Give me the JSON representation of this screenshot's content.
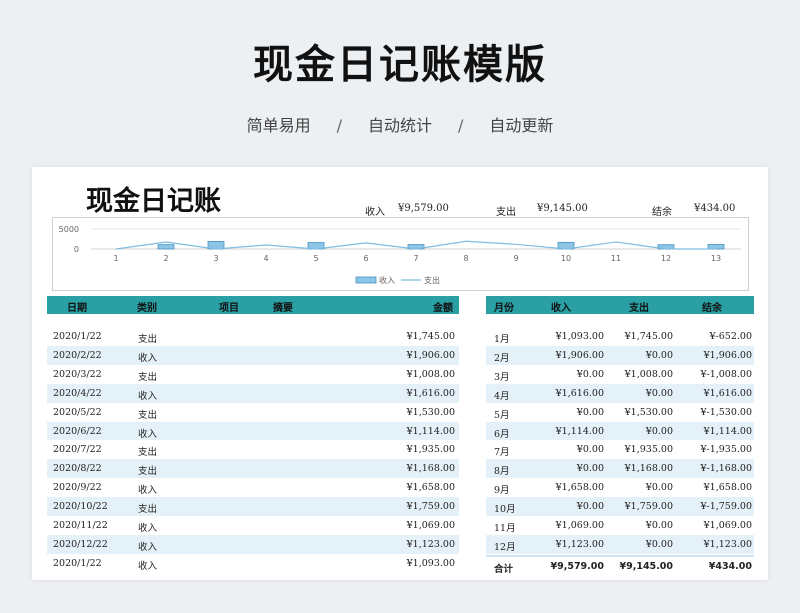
{
  "page": {
    "title": "现金日记账模版",
    "taglines": [
      "简单易用",
      "自动统计",
      "自动更新"
    ],
    "separator": "/"
  },
  "sheet": {
    "title": "现金日记账",
    "summary": [
      {
        "label": "收入",
        "value": "¥9,579.00"
      },
      {
        "label": "支出",
        "value": "¥9,145.00"
      },
      {
        "label": "结余",
        "value": "¥434.00"
      }
    ]
  },
  "chart_data": {
    "type": "bar",
    "x": [
      1,
      2,
      3,
      4,
      5,
      6,
      7,
      8,
      9,
      10,
      11,
      12,
      13
    ],
    "yticks": [
      "5000",
      "0"
    ],
    "ylim": [
      0,
      5000
    ],
    "series": [
      {
        "name": "收入",
        "type": "bar",
        "values": [
          0,
          1093,
          1906,
          0,
          1616,
          0,
          1114,
          0,
          0,
          1658,
          0,
          1069,
          1123
        ]
      },
      {
        "name": "支出",
        "type": "line",
        "values": [
          0,
          1745,
          0,
          1008,
          0,
          1530,
          0,
          1935,
          1168,
          0,
          1759,
          0,
          0
        ]
      }
    ],
    "colors": {
      "bar": "#8cc5e6",
      "bar_stroke": "#4a90c2",
      "line": "#7fbde0"
    },
    "legend": "bottom"
  },
  "ledger": {
    "headers": {
      "date": "日期",
      "category": "类别",
      "item": "项目",
      "note": "摘要",
      "amount": "金额"
    },
    "rows": [
      {
        "date": "2020/1/22",
        "category": "支出",
        "amount": "¥1,745.00"
      },
      {
        "date": "2020/2/22",
        "category": "收入",
        "amount": "¥1,906.00"
      },
      {
        "date": "2020/3/22",
        "category": "支出",
        "amount": "¥1,008.00"
      },
      {
        "date": "2020/4/22",
        "category": "收入",
        "amount": "¥1,616.00"
      },
      {
        "date": "2020/5/22",
        "category": "支出",
        "amount": "¥1,530.00"
      },
      {
        "date": "2020/6/22",
        "category": "收入",
        "amount": "¥1,114.00"
      },
      {
        "date": "2020/7/22",
        "category": "支出",
        "amount": "¥1,935.00"
      },
      {
        "date": "2020/8/22",
        "category": "支出",
        "amount": "¥1,168.00"
      },
      {
        "date": "2020/9/22",
        "category": "收入",
        "amount": "¥1,658.00"
      },
      {
        "date": "2020/10/22",
        "category": "支出",
        "amount": "¥1,759.00"
      },
      {
        "date": "2020/11/22",
        "category": "收入",
        "amount": "¥1,069.00"
      },
      {
        "date": "2020/12/22",
        "category": "收入",
        "amount": "¥1,123.00"
      },
      {
        "date": "2020/1/22",
        "category": "收入",
        "amount": "¥1,093.00"
      }
    ]
  },
  "monthly": {
    "headers": {
      "month": "月份",
      "income": "收入",
      "expense": "支出",
      "balance": "结余"
    },
    "rows": [
      {
        "month": "1月",
        "income": "¥1,093.00",
        "expense": "¥1,745.00",
        "balance": "¥-652.00"
      },
      {
        "month": "2月",
        "income": "¥1,906.00",
        "expense": "¥0.00",
        "balance": "¥1,906.00"
      },
      {
        "month": "3月",
        "income": "¥0.00",
        "expense": "¥1,008.00",
        "balance": "¥-1,008.00"
      },
      {
        "month": "4月",
        "income": "¥1,616.00",
        "expense": "¥0.00",
        "balance": "¥1,616.00"
      },
      {
        "month": "5月",
        "income": "¥0.00",
        "expense": "¥1,530.00",
        "balance": "¥-1,530.00"
      },
      {
        "month": "6月",
        "income": "¥1,114.00",
        "expense": "¥0.00",
        "balance": "¥1,114.00"
      },
      {
        "month": "7月",
        "income": "¥0.00",
        "expense": "¥1,935.00",
        "balance": "¥-1,935.00"
      },
      {
        "month": "8月",
        "income": "¥0.00",
        "expense": "¥1,168.00",
        "balance": "¥-1,168.00"
      },
      {
        "month": "9月",
        "income": "¥1,658.00",
        "expense": "¥0.00",
        "balance": "¥1,658.00"
      },
      {
        "month": "10月",
        "income": "¥0.00",
        "expense": "¥1,759.00",
        "balance": "¥-1,759.00"
      },
      {
        "month": "11月",
        "income": "¥1,069.00",
        "expense": "¥0.00",
        "balance": "¥1,069.00"
      },
      {
        "month": "12月",
        "income": "¥1,123.00",
        "expense": "¥0.00",
        "balance": "¥1,123.00"
      }
    ],
    "total": {
      "month": "合计",
      "income": "¥9,579.00",
      "expense": "¥9,145.00",
      "balance": "¥434.00"
    }
  }
}
